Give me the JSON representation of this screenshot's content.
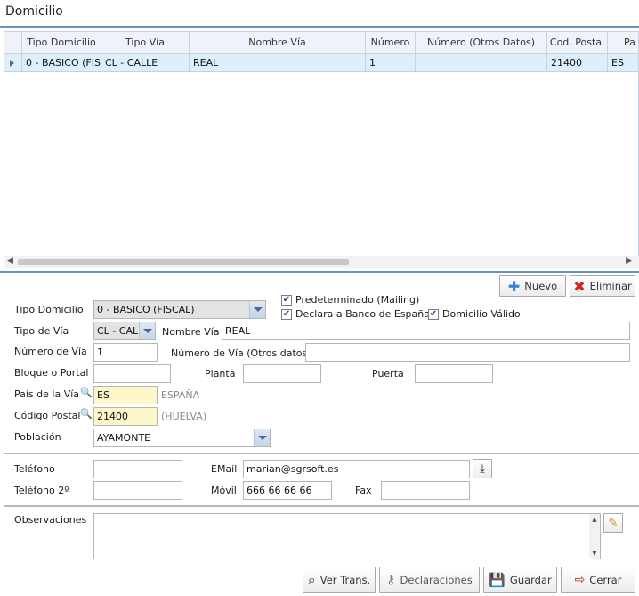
{
  "header": {
    "title": "Domicilio"
  },
  "grid": {
    "columns": [
      "Tipo Domicilio",
      "Tipo Vía",
      "Nombre Vía",
      "Número",
      "Número (Otros Datos)",
      "Cod. Postal",
      "Pa"
    ],
    "rows": [
      [
        "0 - BASICO (FIS...",
        "CL - CALLE",
        "REAL",
        "1",
        "",
        "21400",
        "ES"
      ]
    ]
  },
  "toolbar": {
    "new_label": "Nuevo",
    "delete_label": "Eliminar"
  },
  "form": {
    "tipo_domicilio": {
      "label": "Tipo Domicilio",
      "value": "0 - BASICO (FISCAL)"
    },
    "predeterminado": {
      "label": "Predeterminado (Mailing)",
      "checked": true
    },
    "declara_banco": {
      "label": "Declara a Banco de España",
      "checked": true
    },
    "domicilio_valido": {
      "label": "Domicilio Válido",
      "checked": true
    },
    "tipo_via": {
      "label": "Tipo de Vía",
      "value": "CL - CALLE"
    },
    "nombre_via": {
      "label": "Nombre Vía",
      "value": "REAL"
    },
    "numero_via": {
      "label": "Número de Vía",
      "value": "1"
    },
    "numero_otros": {
      "label": "Número de Vía (Otros datos)",
      "value": ""
    },
    "bloque": {
      "label": "Bloque o Portal",
      "value": ""
    },
    "planta": {
      "label": "Planta",
      "value": ""
    },
    "puerta": {
      "label": "Puerta",
      "value": ""
    },
    "pais": {
      "label": "País de la Vía",
      "value": "ES",
      "hint": "ESPAÑA"
    },
    "codigo_postal": {
      "label": "Código Postal",
      "value": "21400",
      "hint": "(HUELVA)"
    },
    "poblacion": {
      "label": "Población",
      "value": "AYAMONTE"
    },
    "telefono": {
      "label": "Teléfono",
      "value": ""
    },
    "email": {
      "label": "EMail",
      "value": "marian@sgrsoft.es"
    },
    "telefono2": {
      "label": "Teléfono 2º",
      "value": ""
    },
    "movil": {
      "label": "Móvil",
      "value": "666 66 66 66"
    },
    "fax": {
      "label": "Fax",
      "value": ""
    },
    "observaciones": {
      "label": "Observaciones",
      "value": ""
    }
  },
  "footer": {
    "ver_trans": "Ver Trans.",
    "declaraciones": "Declaraciones",
    "guardar": "Guardar",
    "cerrar": "Cerrar"
  },
  "colors": {
    "accent": "#6b8fbf",
    "selected_row": "#dfeefb",
    "required_field": "#fdf6c8"
  }
}
